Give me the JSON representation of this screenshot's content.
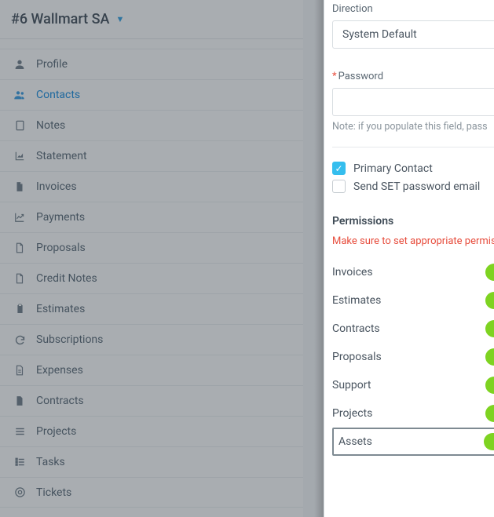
{
  "header": {
    "title": "#6 Wallmart SA"
  },
  "sidebar": {
    "items": [
      {
        "label": "Profile"
      },
      {
        "label": "Contacts"
      },
      {
        "label": "Notes"
      },
      {
        "label": "Statement"
      },
      {
        "label": "Invoices"
      },
      {
        "label": "Payments"
      },
      {
        "label": "Proposals"
      },
      {
        "label": "Credit Notes"
      },
      {
        "label": "Estimates"
      },
      {
        "label": "Subscriptions"
      },
      {
        "label": "Expenses"
      },
      {
        "label": "Contracts"
      },
      {
        "label": "Projects"
      },
      {
        "label": "Tasks"
      },
      {
        "label": "Tickets"
      }
    ]
  },
  "panel": {
    "direction_label": "Direction",
    "direction_value": "System Default",
    "password_label": "Password",
    "password_hint": "Note: if you populate this field, pass",
    "primary_contact_label": "Primary Contact",
    "send_set_pw_label": "Send SET password email",
    "permissions_title": "Permissions",
    "permissions_warning": "Make sure to set appropriate permis",
    "perms": [
      {
        "label": "Invoices"
      },
      {
        "label": "Estimates"
      },
      {
        "label": "Contracts"
      },
      {
        "label": "Proposals"
      },
      {
        "label": "Support"
      },
      {
        "label": "Projects"
      },
      {
        "label": "Assets"
      }
    ]
  }
}
